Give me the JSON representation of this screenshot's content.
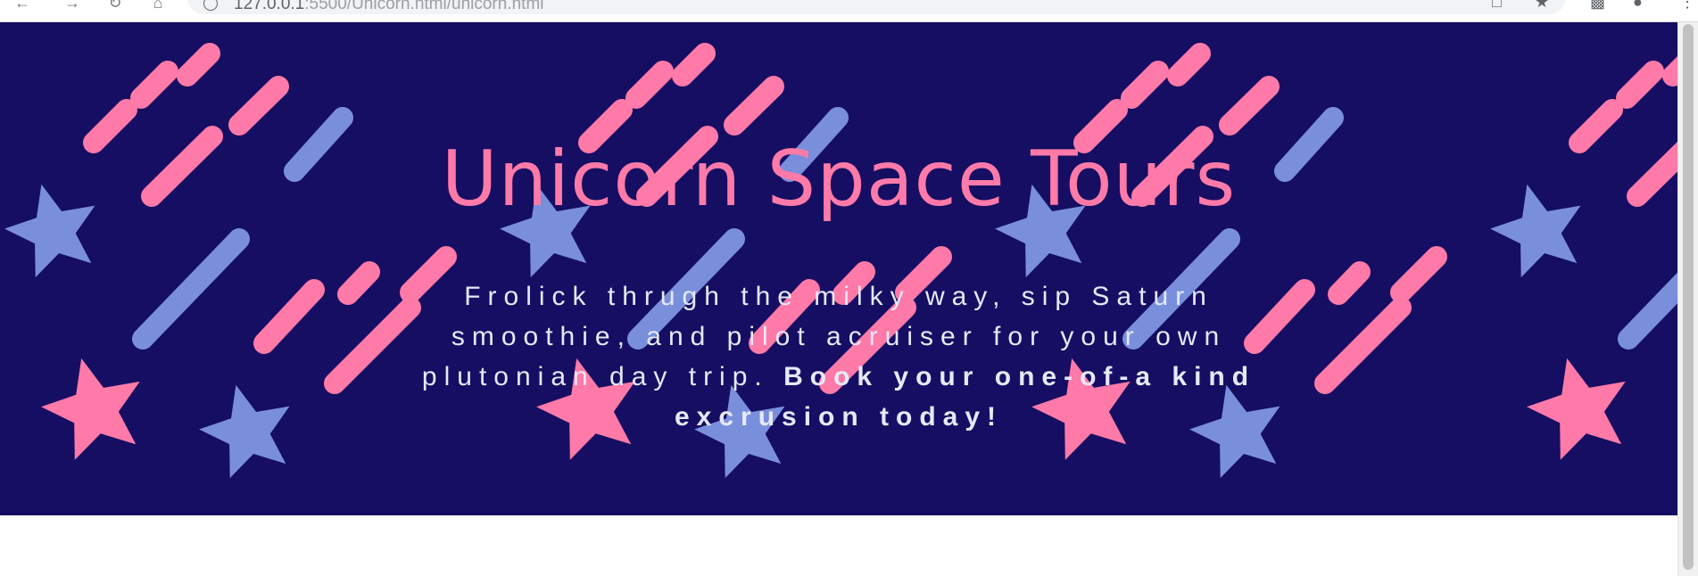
{
  "browser": {
    "url_host": "127.0.0.1",
    "url_rest": ":5500/Unicorn.html/unicorn.html",
    "icons": [
      "back-arrow-icon",
      "forward-arrow-icon",
      "reload-icon",
      "home-icon",
      "site-info-icon",
      "install-icon",
      "bookmark-star-icon",
      "extensions-icon",
      "profile-icon",
      "menu-icon"
    ]
  },
  "hero": {
    "title": "Unicorn Space Tours",
    "text_plain": "Frolick thrugh the milky way, sip Saturn smoothie, and pilot acruiser for your own plutonian day trip. ",
    "text_bold": "Book your one-of-a kind excrusion today!",
    "colors": {
      "background": "#160e63",
      "pink": "#ff7aa8",
      "blue": "#7a8fdc",
      "text": "#e6e8f8"
    }
  }
}
